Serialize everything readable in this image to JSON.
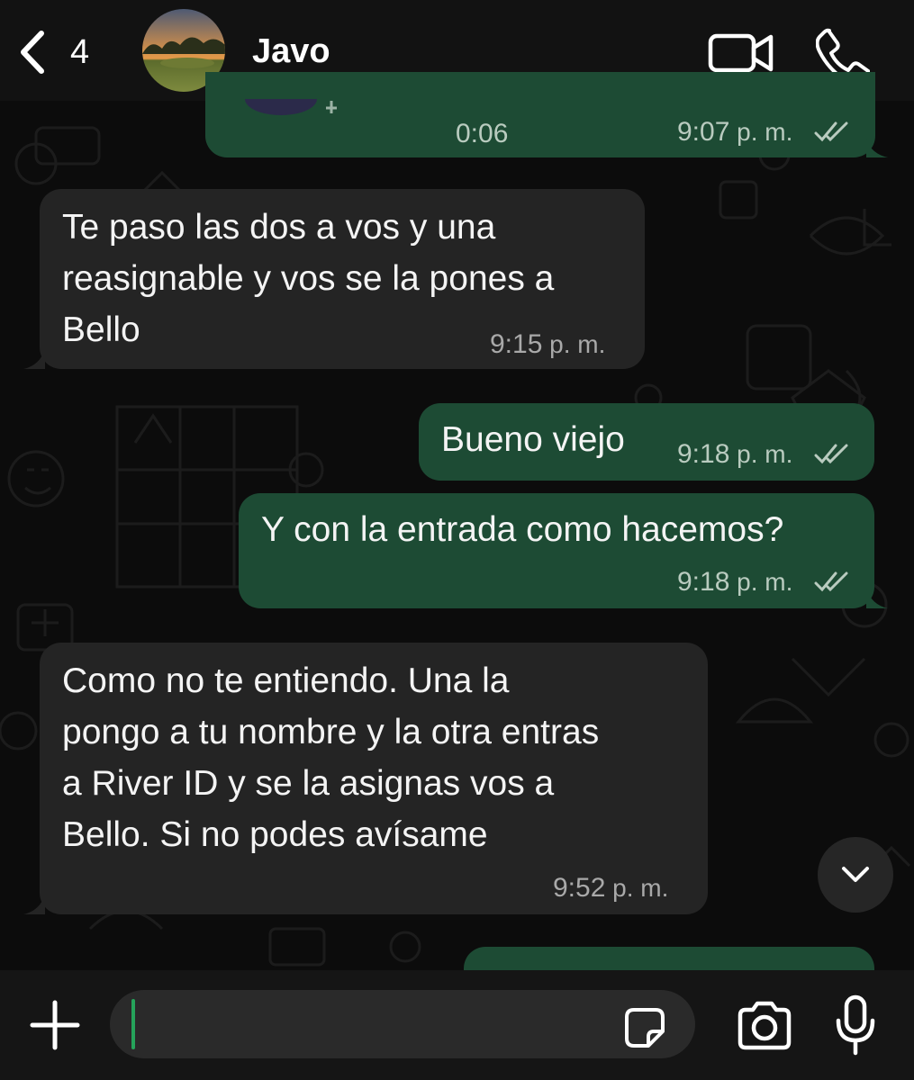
{
  "header": {
    "back_count": "4",
    "contact_name": "Javo"
  },
  "messages": [
    {
      "direction": "outgoing",
      "kind": "audio",
      "duration": "0:06",
      "time": "9:07",
      "time_suffix": "p. m.",
      "status": "read"
    },
    {
      "direction": "incoming",
      "text": "Te paso las dos a vos y una\nreasignable y vos se la pones a\nBello",
      "time": "9:15",
      "time_suffix": "p. m."
    },
    {
      "direction": "outgoing",
      "text": "Bueno viejo",
      "time": "9:18",
      "time_suffix": "p. m.",
      "status": "read"
    },
    {
      "direction": "outgoing",
      "text": "Y con la entrada como hacemos?",
      "time": "9:18",
      "time_suffix": "p. m.",
      "status": "read"
    },
    {
      "direction": "incoming",
      "text": "Como no te entiendo. Una la\npongo a tu nombre y la otra entras\na River ID y se la asignas vos a\nBello. Si no podes avísame",
      "time": "9:52",
      "time_suffix": "p. m."
    }
  ],
  "icons": {
    "back": "chevron-left-icon",
    "video": "video-camera-icon",
    "phone": "phone-icon",
    "scroll": "chevron-down-icon",
    "plus": "plus-icon",
    "sticker": "sticker-icon",
    "camera": "camera-icon",
    "mic": "microphone-icon"
  },
  "colors": {
    "incoming_bubble": "#242424",
    "outgoing_bubble": "#1d4b34",
    "caret": "#25a35a"
  }
}
